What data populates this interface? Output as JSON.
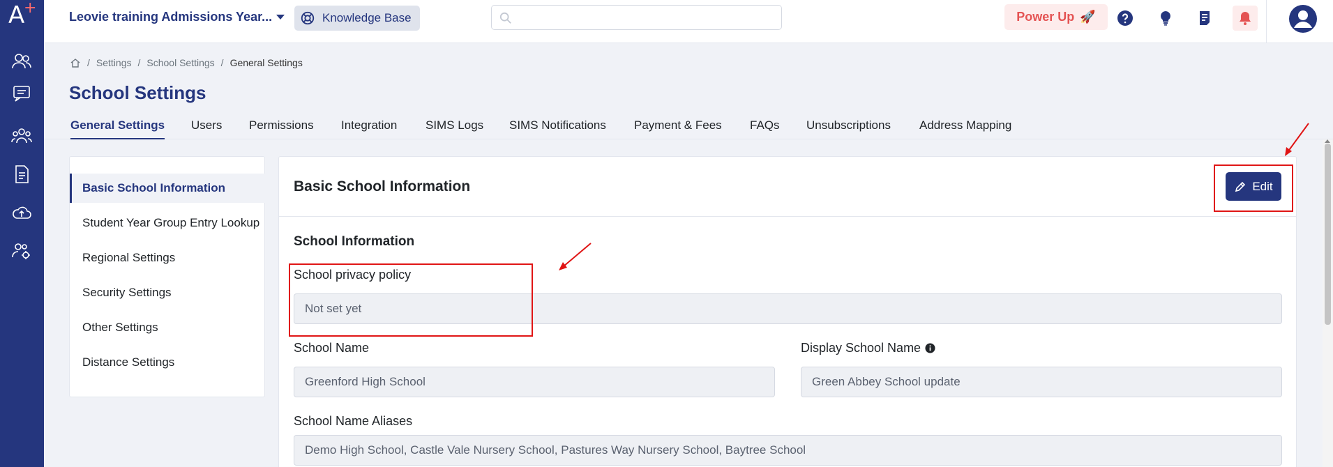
{
  "app": {
    "logo_text": "A",
    "logo_plus": "+"
  },
  "header": {
    "title": "Leovie training Admissions Year...",
    "knowledge_base": "Knowledge Base",
    "search_placeholder": "",
    "power_up": "Power Up",
    "power_up_emoji": "🚀"
  },
  "breadcrumb": {
    "items": [
      "Settings",
      "School Settings",
      "General Settings"
    ],
    "sep": "/"
  },
  "page": {
    "title": "School Settings"
  },
  "tabs": [
    "General Settings",
    "Users",
    "Permissions",
    "Integration",
    "SIMS Logs",
    "SIMS Notifications",
    "Payment & Fees",
    "FAQs",
    "Unsubscriptions",
    "Address Mapping"
  ],
  "side_nav": [
    "Basic School Information",
    "Student Year Group Entry Lookup",
    "Regional Settings",
    "Security Settings",
    "Other Settings",
    "Distance Settings"
  ],
  "card": {
    "title": "Basic School Information",
    "edit_label": "Edit",
    "section_title": "School Information",
    "fields": {
      "privacy_label": "School privacy policy",
      "privacy_value": "Not set yet",
      "name_label": "School Name",
      "name_value": "Greenford High School",
      "display_label": "Display School Name",
      "display_value": "Green Abbey School update",
      "aliases_label": "School Name Aliases",
      "aliases_value": "Demo High School, Castle Vale Nursery School, Pastures Way Nursery School, Baytree School"
    }
  },
  "colors": {
    "brand": "#25367e",
    "accent_red": "#e01515",
    "power_up_bg": "#fdecec"
  }
}
